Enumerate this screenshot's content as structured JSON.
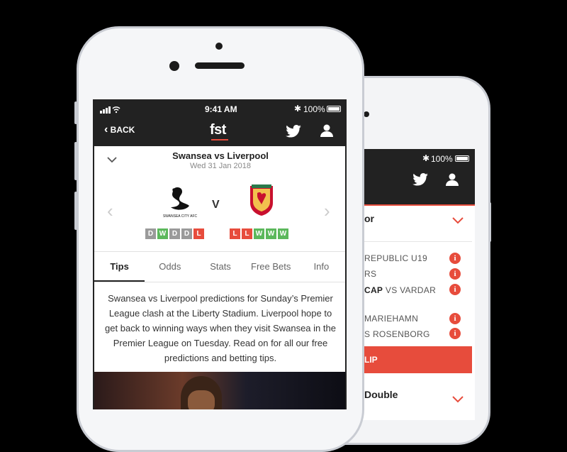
{
  "back_phone": {
    "status_battery": "100%",
    "section_title_fragment": "or",
    "items": [
      {
        "text": "REPUBLIC U19",
        "bold": ""
      },
      {
        "text": "RS",
        "bold": ""
      },
      {
        "text": " VS VARDAR",
        "bold": "CAP"
      },
      {
        "text": "MARIEHAMN",
        "bold": ""
      },
      {
        "text": "S ROSENBORG",
        "bold": ""
      }
    ],
    "cta_fragment": "LIP",
    "section2_title_fragment": "Double"
  },
  "status": {
    "time": "9:41 AM",
    "battery": "100%"
  },
  "nav": {
    "back_label": "BACK",
    "logo": "fst"
  },
  "match": {
    "title": "Swansea vs Liverpool",
    "date": "Wed 31 Jan 2018",
    "versus": "V",
    "home_form": [
      "D",
      "W",
      "D",
      "D",
      "L"
    ],
    "away_form": [
      "L",
      "L",
      "W",
      "W",
      "W"
    ]
  },
  "tabs": [
    "Tips",
    "Odds",
    "Stats",
    "Free Bets",
    "Info"
  ],
  "article": "Swansea vs Liverpool predictions for Sunday’s Premier League clash at the Liberty Stadium. Liverpool hope to get back to winning ways when they visit Swansea in the Premier League on Tuesday. Read on for all our free predictions and betting tips.",
  "colors": {
    "accent": "#e74c3c",
    "win": "#5cb85c",
    "draw": "#9a9a9a",
    "dark": "#222222"
  }
}
